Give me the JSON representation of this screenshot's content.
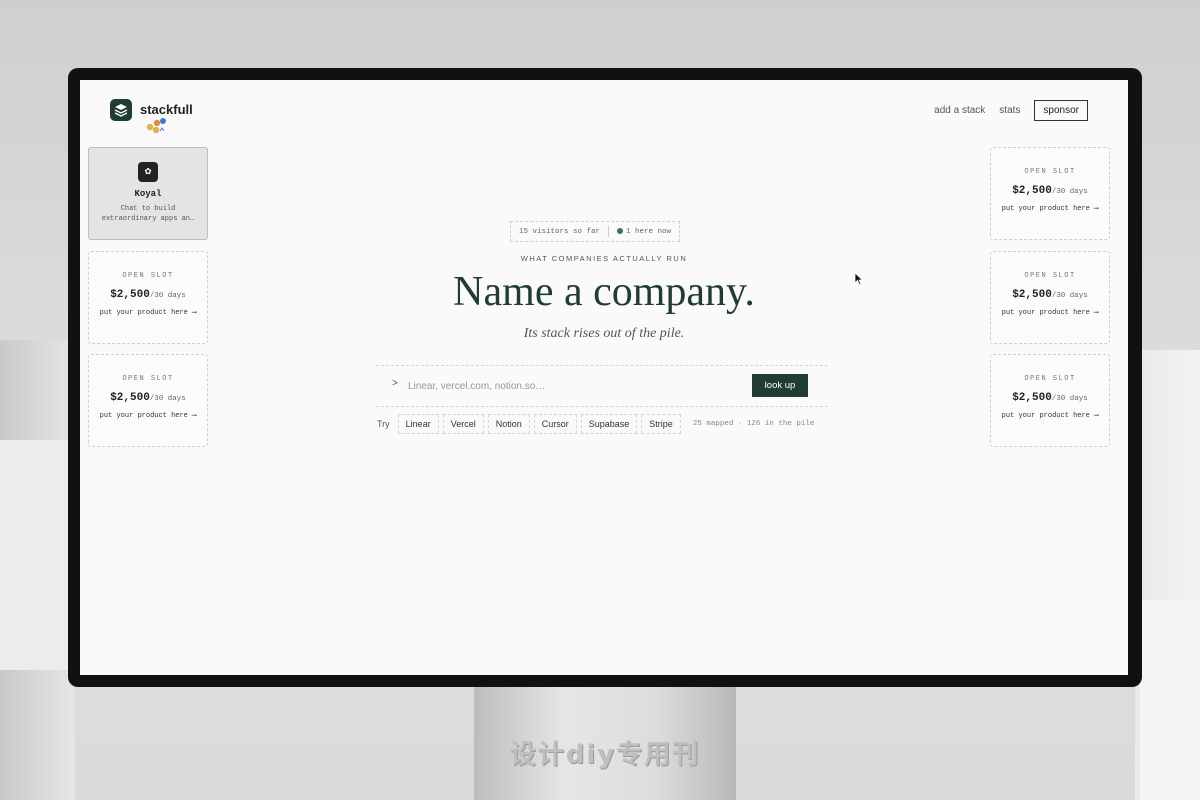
{
  "header": {
    "brand": "stackfull",
    "nav": [
      {
        "label": "add a stack"
      },
      {
        "label": "stats"
      },
      {
        "label": "sponsor"
      }
    ]
  },
  "sponsored_card": {
    "name": "Koyal",
    "description": "Chat to build extraordinary apps an…"
  },
  "open_slot": {
    "kicker": "OPEN SLOT",
    "price": "$2,500",
    "period": "/30 days",
    "cta": "put your product here ⟶"
  },
  "hero": {
    "visitors": "15 visitors so far",
    "live": "1 here now",
    "kicker": "WHAT COMPANIES ACTUALLY RUN",
    "headline": "Name a company.",
    "subtitle": "Its stack rises out of the pile."
  },
  "search": {
    "prompt": ">",
    "placeholder": "Linear, vercel.com, notion.so…",
    "button": "look up"
  },
  "try": {
    "label": "Try",
    "chips": [
      "Linear",
      "Vercel",
      "Notion",
      "Cursor",
      "Supabase",
      "Stripe"
    ],
    "counts": "25 mapped · 126 in the pile"
  },
  "stand_watermark": "设计diy专用刊",
  "colors": {
    "accent": "#1f3d30",
    "live": "#2f7a55",
    "logo_dots": [
      "#e0b04a",
      "#e08a3a",
      "#3a7ad6"
    ]
  }
}
